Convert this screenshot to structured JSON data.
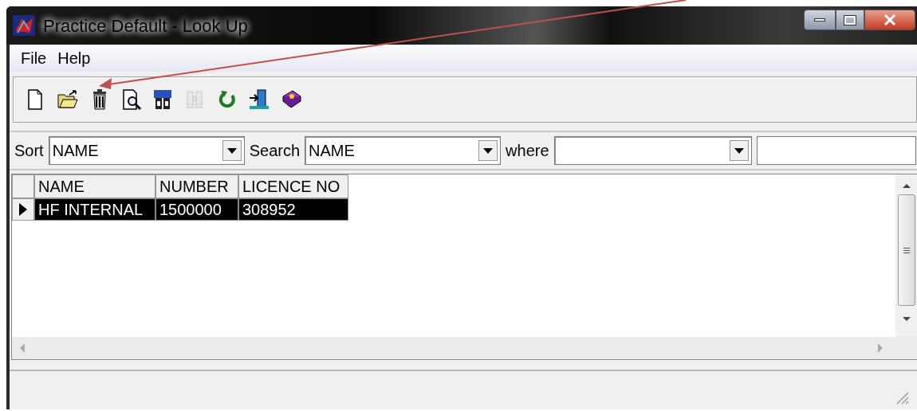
{
  "window": {
    "title": "Practice Default - Look Up"
  },
  "menu": [
    "File",
    "Help"
  ],
  "toolbar": [
    {
      "kind": "new",
      "disabled": false
    },
    {
      "kind": "open",
      "disabled": false
    },
    {
      "kind": "delete",
      "disabled": false
    },
    {
      "kind": "preview",
      "disabled": false
    },
    {
      "kind": "search",
      "disabled": false
    },
    {
      "kind": "find",
      "disabled": true
    },
    {
      "kind": "refresh",
      "disabled": false
    },
    {
      "kind": "exit",
      "disabled": false
    },
    {
      "kind": "help",
      "disabled": false
    }
  ],
  "filter": {
    "sort_label": "Sort",
    "sort_value": "NAME",
    "search_label": "Search",
    "search_value": "NAME",
    "where_label": "where"
  },
  "table": {
    "columns": [
      "NAME",
      "NUMBER",
      "LICENCE NO"
    ],
    "rows": [
      {
        "cells": [
          "HF INTERNAL",
          "1500000",
          "308952"
        ],
        "selected": true
      }
    ]
  }
}
